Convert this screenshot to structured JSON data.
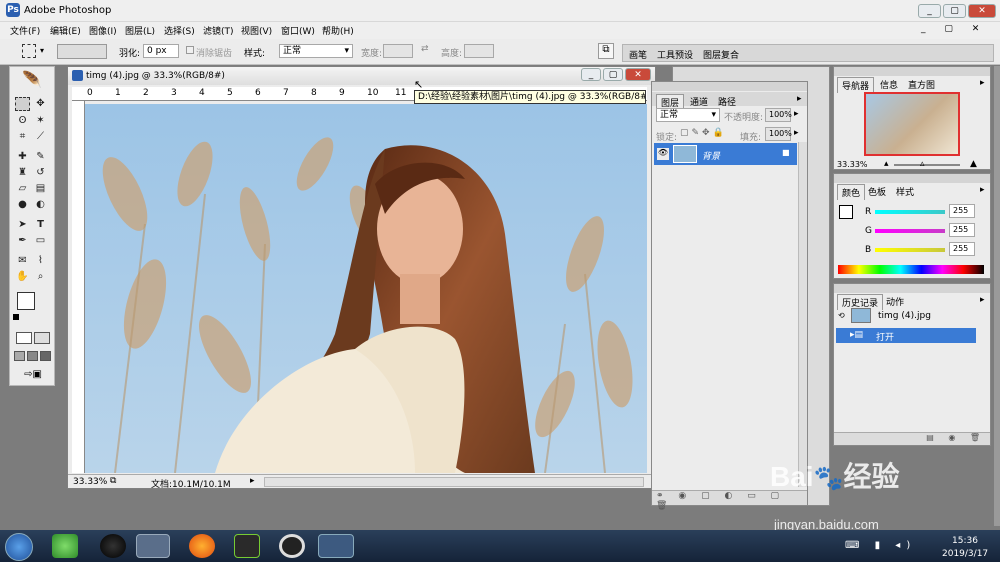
{
  "app": {
    "title": "Adobe Photoshop",
    "icon": "photoshop-feather-icon"
  },
  "window_controls": {
    "minimize": "_",
    "restore": "▢",
    "close": "✕"
  },
  "menu": [
    "文件(F)",
    "编辑(E)",
    "图像(I)",
    "图层(L)",
    "选择(S)",
    "滤镜(T)",
    "视图(V)",
    "窗口(W)",
    "帮助(H)"
  ],
  "options": {
    "feather_label": "羽化:",
    "feather_value": "0 px",
    "antialias_label": "消除锯齿",
    "style_label": "样式:",
    "style_value": "正常",
    "width_label": "宽度:",
    "height_label": "高度:",
    "well_tabs": [
      "画笔",
      "工具预设",
      "图层复合"
    ]
  },
  "document": {
    "title": "timg (4).jpg @ 33.3%(RGB/8#)",
    "tooltip": "D:\\经验\\经验素材\\图片\\timg (4).jpg @ 33.3%(RGB/8#)",
    "zoom": "33.33%",
    "doc_size": "文档:10.1M/10.1M",
    "ruler_numbers": [
      "0",
      "1",
      "2",
      "3",
      "4",
      "5",
      "6",
      "7",
      "8",
      "9",
      "10",
      "11"
    ]
  },
  "layers_panel": {
    "tabs": [
      "图层",
      "通道",
      "路径"
    ],
    "blend_mode": "正常",
    "opacity_label": "不透明度:",
    "opacity_value": "100%",
    "lock_label": "锁定:",
    "fill_label": "填充:",
    "fill_value": "100%",
    "layer_name": "背景"
  },
  "navigator_panel": {
    "tabs": [
      "导航器",
      "信息",
      "直方图"
    ],
    "zoom": "33.33%"
  },
  "color_panel": {
    "tabs": [
      "颜色",
      "色板",
      "样式"
    ],
    "channels": [
      {
        "label": "R",
        "value": "255",
        "color": "#3cc8c8"
      },
      {
        "label": "G",
        "value": "255",
        "color": "#c83cc8"
      },
      {
        "label": "B",
        "value": "255",
        "color": "#c8c83c"
      }
    ]
  },
  "history_panel": {
    "tabs": [
      "历史记录",
      "动作"
    ],
    "snapshot": "timg (4).jpg",
    "step": "打开"
  },
  "taskbar": {
    "time": "15:36",
    "date": "2019/3/17",
    "apps": [
      "windows-start-icon",
      "360-browser-icon",
      "qq-icon",
      "file-explorer-icon",
      "firefox-icon",
      "media-player-icon",
      "record-icon",
      "photoshop-icon"
    ]
  },
  "watermark": {
    "brand": "Bai",
    "brand2": "经验",
    "url": "jingyan.baidu.com"
  }
}
